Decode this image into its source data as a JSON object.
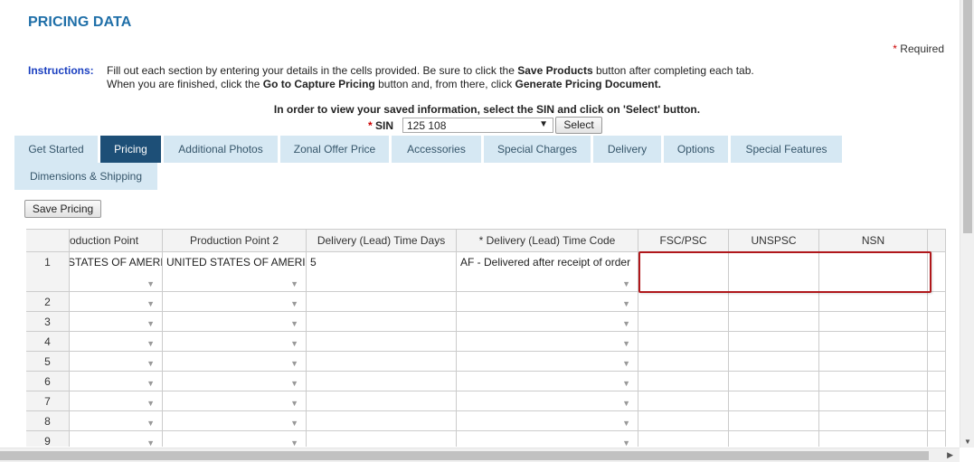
{
  "page_title": "PRICING DATA",
  "required_note": {
    "star": "*",
    "text": " Required"
  },
  "instructions": {
    "label": "Instructions:",
    "line1_parts": [
      "Fill out each section by entering your details in the cells provided. Be sure to click the ",
      "Save Products",
      " button after completing each tab."
    ],
    "line2_parts": [
      "When you are finished, click the ",
      "Go to Capture Pricing",
      " button and, from there, click ",
      "Generate Pricing Document."
    ]
  },
  "sin_prompt": "In order to view your saved information, select the SIN and click on 'Select' button.",
  "sin": {
    "star": "*",
    "label": "SIN",
    "selected": "125 108",
    "select_button": "Select"
  },
  "tabs": [
    "Get Started",
    "Pricing",
    "Additional Photos",
    "Zonal Offer Price",
    "Accessories",
    "Special Charges",
    "Delivery",
    "Options",
    "Special Features",
    "Dimensions & Shipping"
  ],
  "active_tab": "Pricing",
  "save_button": "Save Pricing",
  "grid": {
    "columns": [
      "oduction Point",
      "Production Point 2",
      "Delivery (Lead) Time Days",
      "* Delivery (Lead) Time Code",
      "FSC/PSC",
      "UNSPSC",
      "NSN"
    ],
    "rows": [
      {
        "num": "1",
        "values": [
          "STATES OF AMERIC",
          "UNITED STATES OF AMERIC",
          "5",
          "AF - Delivered after receipt of order",
          "",
          "",
          ""
        ]
      },
      {
        "num": "2",
        "values": [
          "",
          "",
          "",
          "",
          "",
          "",
          ""
        ]
      },
      {
        "num": "3",
        "values": [
          "",
          "",
          "",
          "",
          "",
          "",
          ""
        ]
      },
      {
        "num": "4",
        "values": [
          "",
          "",
          "",
          "",
          "",
          "",
          ""
        ]
      },
      {
        "num": "5",
        "values": [
          "",
          "",
          "",
          "",
          "",
          "",
          ""
        ]
      },
      {
        "num": "6",
        "values": [
          "",
          "",
          "",
          "",
          "",
          "",
          ""
        ]
      },
      {
        "num": "7",
        "values": [
          "",
          "",
          "",
          "",
          "",
          "",
          ""
        ]
      },
      {
        "num": "8",
        "values": [
          "",
          "",
          "",
          "",
          "",
          "",
          ""
        ]
      },
      {
        "num": "9",
        "values": [
          "",
          "",
          "",
          "",
          "",
          "",
          ""
        ]
      }
    ],
    "dropdown_columns": [
      0,
      1,
      3
    ]
  },
  "colors": {
    "title": "#1f6fa8",
    "active_tab": "#1d4f77",
    "tab": "#d6e8f3",
    "highlight": "#b0171b"
  },
  "icons": {
    "dropdown": "triangle-down-icon",
    "scroll_down": "arrow-down-icon",
    "scroll_right": "arrow-right-icon"
  }
}
